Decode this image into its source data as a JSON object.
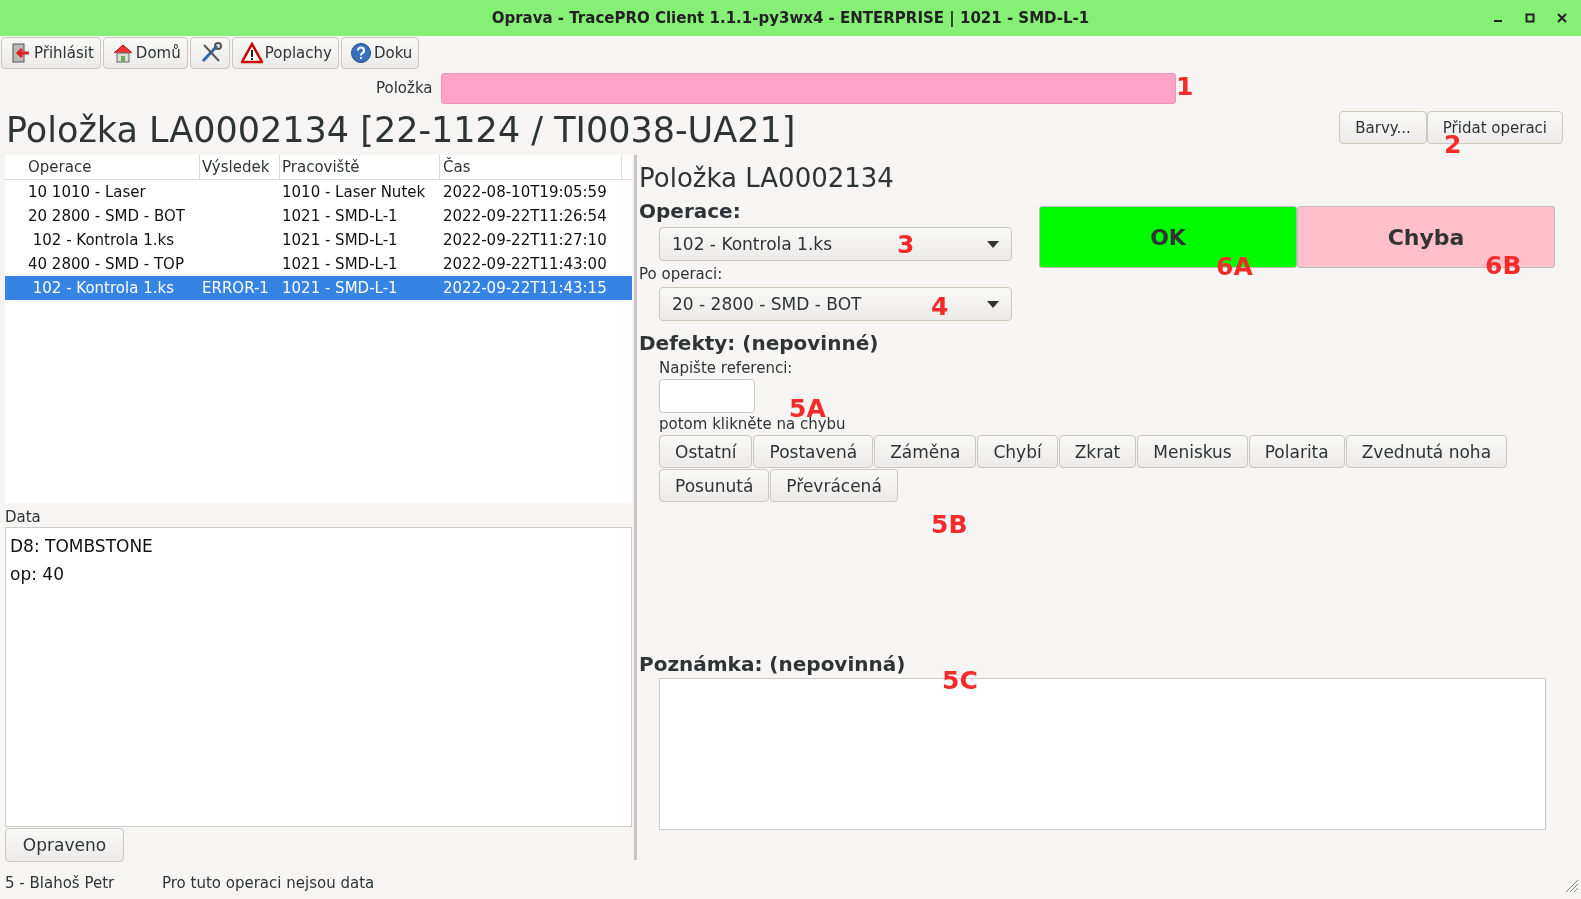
{
  "window": {
    "title": "Oprava - TracePRO Client 1.1.1-py3wx4 - ENTERPRISE | 1021 - SMD-L-1"
  },
  "toolbar": [
    {
      "label": "Přihlásit",
      "kind": "login"
    },
    {
      "label": "Domů",
      "kind": "home"
    },
    {
      "kind": "tools"
    },
    {
      "label": "Poplachy",
      "kind": "alarm"
    },
    {
      "label": "Doku",
      "kind": "help"
    }
  ],
  "item_field": {
    "label": "Položka"
  },
  "heading": "Položka LA0002134 [22-1124 / TI0038-UA21]",
  "header_buttons": [
    "Barvy...",
    "Přidat operaci"
  ],
  "table": {
    "columns": [
      "Operace",
      "Výsledek",
      "Pracoviště",
      "Čas"
    ],
    "rows": [
      {
        "cells": [
          "10 1010 - Laser",
          "",
          "1010 - Laser Nutek",
          "2022-08-10T19:05:59"
        ],
        "selected": false
      },
      {
        "cells": [
          "20 2800 - SMD - BOT",
          "",
          "1021 - SMD-L-1",
          "2022-09-22T11:26:54"
        ],
        "selected": false
      },
      {
        "cells": [
          " 102 - Kontrola 1.ks",
          "",
          "1021 - SMD-L-1",
          "2022-09-22T11:27:10"
        ],
        "selected": false
      },
      {
        "cells": [
          "40 2800 - SMD - TOP",
          "",
          "1021 - SMD-L-1",
          "2022-09-22T11:43:00"
        ],
        "selected": false
      },
      {
        "cells": [
          " 102 - Kontrola 1.ks",
          "ERROR-1",
          "1021 - SMD-L-1",
          "2022-09-22T11:43:15"
        ],
        "selected": true
      }
    ]
  },
  "data": {
    "label": "Data",
    "lines": [
      "D8: TOMBSTONE",
      "op: 40"
    ]
  },
  "fixed_button": "Opraveno",
  "status_bar": [
    "5 - Blahoš Petr",
    "Pro tuto operaci nejsou data"
  ],
  "detail": {
    "title": "Položka LA0002134",
    "operation_label": "Operace:",
    "operation": "102 - Kontrola 1.ks",
    "after_label": "Po operaci:",
    "after": "20 - 2800 - SMD - BOT",
    "ok": "OK",
    "error": "Chyba",
    "defects_label": "Defekty: (nepovinné)",
    "reference_label": "Napište referenci:",
    "click_hint": "potom klikněte na chybu",
    "defects": [
      "Ostatní",
      "Postavená",
      "Záměna",
      "Chybí",
      "Zkrat",
      "Meniskus",
      "Polarita",
      "Zvednutá noha",
      "Posunutá",
      "Převrácená"
    ],
    "note_label": "Poznámka: (nepovinná)"
  },
  "annotations": [
    "1",
    "2",
    "3",
    "4",
    "5A",
    "5B",
    "5C",
    "6A",
    "6B"
  ]
}
